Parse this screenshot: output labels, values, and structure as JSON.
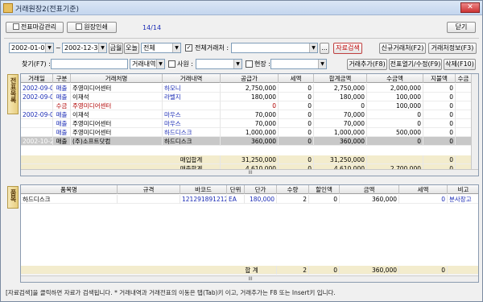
{
  "window": {
    "title": "거래원장2(전표기준)",
    "close": "✕"
  },
  "toolbar": {
    "slip_close": "전표마감관리",
    "print": "원장인쇄",
    "page": "14/14",
    "close": "닫기"
  },
  "filters": {
    "date_from": "2002-01-01",
    "tilde": "~",
    "date_to": "2002-12-31",
    "btn_year": "금월",
    "btn_today": "오늘",
    "type": "전체",
    "all_clients_label": "전체거래처 :",
    "client": "",
    "dots": "...",
    "search": "자료검색",
    "new_client": "신규거래처(F2)",
    "client_info": "거래처정보(F3)",
    "find_label": "찾기(F7) :",
    "find_value": "",
    "detail_combo": "거래내역",
    "emp_label": "사원 :",
    "emp_value": "",
    "site_label": "현장 :",
    "site_value": "",
    "add_trans": "거래추가(F8)",
    "open_slip": "전표열기/수정(F9)",
    "delete": "삭제(F10)"
  },
  "slip_tab": "전표목록",
  "item_tab": "품목",
  "slip_grid": {
    "columns": [
      "거래일",
      "구분",
      "거래처명",
      "거래내역",
      "공급가",
      "세액",
      "합계금액",
      "수금액",
      "지불액",
      "수금"
    ],
    "rows": [
      {
        "date": "2002-09-01",
        "kind": "매출",
        "client": "주영미디어센터",
        "desc": "하모니",
        "supply": "2,750,000",
        "tax": "0",
        "total": "2,750,000",
        "recv": "2,000,000",
        "paid": "0",
        "style": "blue"
      },
      {
        "date": "2002-09-05",
        "kind": "매출",
        "client": "이재석",
        "desc": "라벨지",
        "supply": "180,000",
        "tax": "0",
        "total": "180,000",
        "recv": "100,000",
        "paid": "0",
        "style": "blue"
      },
      {
        "date": "",
        "kind": "수금",
        "client": "주영미디어센터",
        "desc": "",
        "supply": "0",
        "tax": "0",
        "total": "0",
        "recv": "100,000",
        "paid": "0",
        "style": "red"
      },
      {
        "date": "2002-09-06",
        "kind": "매출",
        "client": "이재석",
        "desc": "마우스",
        "supply": "70,000",
        "tax": "0",
        "total": "70,000",
        "recv": "0",
        "paid": "0",
        "style": "blue"
      },
      {
        "date": "",
        "kind": "매출",
        "client": "주영미디어센터",
        "desc": "마우스",
        "supply": "70,000",
        "tax": "0",
        "total": "70,000",
        "recv": "0",
        "paid": "0",
        "style": "blue"
      },
      {
        "date": "",
        "kind": "매출",
        "client": "주영미디어센터",
        "desc": "하드디스크",
        "supply": "1,000,000",
        "tax": "0",
        "total": "1,000,000",
        "recv": "500,000",
        "paid": "0",
        "style": "blue"
      },
      {
        "date": "2002-10-23",
        "kind": "매출",
        "client": "(주)소프트닷컴",
        "desc": "하드디스크",
        "supply": "360,000",
        "tax": "0",
        "total": "360,000",
        "recv": "0",
        "paid": "0",
        "style": "sel"
      }
    ],
    "sum_rows": [
      {
        "label": "매입합계",
        "supply": "31,250,000",
        "tax": "0",
        "total": "31,250,000",
        "recv": "",
        "paid": "0"
      },
      {
        "label": "매출합계",
        "supply": "4,610,000",
        "tax": "0",
        "total": "4,610,000",
        "recv": "2,700,000",
        "paid": "0"
      }
    ]
  },
  "item_grid": {
    "columns": [
      "품목명",
      "규격",
      "바코드",
      "단위",
      "단가",
      "수량",
      "할인액",
      "금액",
      "세액",
      "비고"
    ],
    "rows": [
      {
        "name": "하드디스크",
        "spec": "",
        "barcode": "121291891212",
        "unit": "EA",
        "price": "180,000",
        "qty": "2",
        "disc": "0",
        "amount": "360,000",
        "tax": "0",
        "note": "분사장고"
      }
    ],
    "total": {
      "label": "합 계",
      "qty": "2",
      "disc": "0",
      "amount": "360,000",
      "tax": "0"
    }
  },
  "scroll_mark": "III",
  "status": "[자료검색]을 클릭하면 자료가 검색됩니다. * 거래내역과 거래전표의 이동은 탭(Tab)키 이고, 거래추가는 F8 또는 Insert키 입니다."
}
